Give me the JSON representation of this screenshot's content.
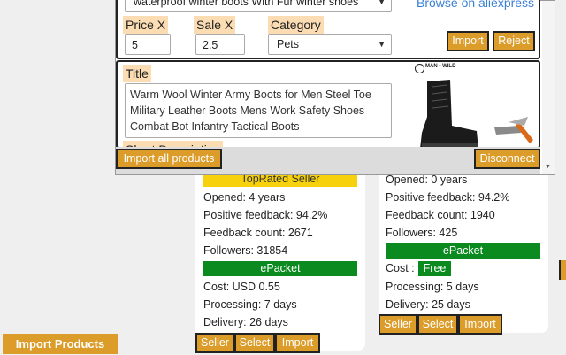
{
  "popup": {
    "top_select_value": "waterproof winter boots With Fur winter shoes",
    "browse_link": "Browse on aliexpress",
    "price_label": "Price X",
    "price_value": "5",
    "sale_label": "Sale X",
    "sale_value": "2.5",
    "category_label": "Category",
    "category_value": "Pets",
    "import_label": "Import",
    "reject_label": "Reject",
    "title_label": "Title",
    "title_text": "Warm Wool Winter Army Boots for Men Steel Toe Military Leather Boots Mens Work Safety Shoes Combat Bot Infantry Tactical Boots",
    "short_desc_label": "Short Description",
    "brand_text": "MAN • WILD",
    "import_all_label": "Import all products",
    "disconnect_label": "Disconnect"
  },
  "card1": {
    "badge": "TopRated Seller",
    "opened": "Opened: 4 years",
    "positive": "Positive feedback: 94.2%",
    "feedback_count": "Feedback count: 2671",
    "followers": "Followers: 31854",
    "shipping_method": "ePacket",
    "cost": "Cost: USD 0.55",
    "processing": "Processing: 7 days",
    "delivery": "Delivery: 26 days",
    "buttons": [
      "Seller",
      "Select",
      "Import"
    ]
  },
  "card2": {
    "opened": "Opened: 0 years",
    "positive": "Positive feedback: 94.2%",
    "feedback_count": "Feedback count: 1940",
    "followers": "Followers: 425",
    "shipping_method": "ePacket",
    "cost_label": "Cost :",
    "cost_value": "Free",
    "processing": "Processing: 5 days",
    "delivery": "Delivery: 25 days",
    "buttons": [
      "Seller",
      "Select",
      "Import"
    ]
  },
  "sidebar": {
    "import_products_label": "Import Products"
  },
  "colors": {
    "accent": "#dc9c2a",
    "label_bg": "#fbdcb3",
    "topseller": "#f7d20c",
    "epacket": "#0a8a1f",
    "link": "#3a7fd8"
  }
}
